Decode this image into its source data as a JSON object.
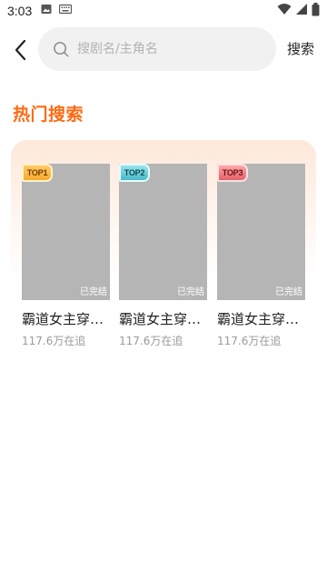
{
  "status_bar": {
    "time": "3:03",
    "icons": [
      "image-icon",
      "keyboard-icon",
      "wifi-icon",
      "signal-icon",
      "battery-icon"
    ]
  },
  "search": {
    "placeholder": "搜剧名/主角名",
    "button_label": "搜索"
  },
  "hot_section": {
    "title": "热门搜索",
    "items": [
      {
        "rank": "TOP1",
        "status": "已完结",
        "title": "霸道女主穿…",
        "meta": "117.6万在追"
      },
      {
        "rank": "TOP2",
        "status": "已完结",
        "title": "霸道女主穿…",
        "meta": "117.6万在追"
      },
      {
        "rank": "TOP3",
        "status": "已完结",
        "title": "霸道女主穿…",
        "meta": "117.6万在追"
      }
    ]
  },
  "colors": {
    "accent": "#ff6a13",
    "poster_placeholder": "#b5b5b5",
    "search_bg": "#f1f1f1"
  }
}
